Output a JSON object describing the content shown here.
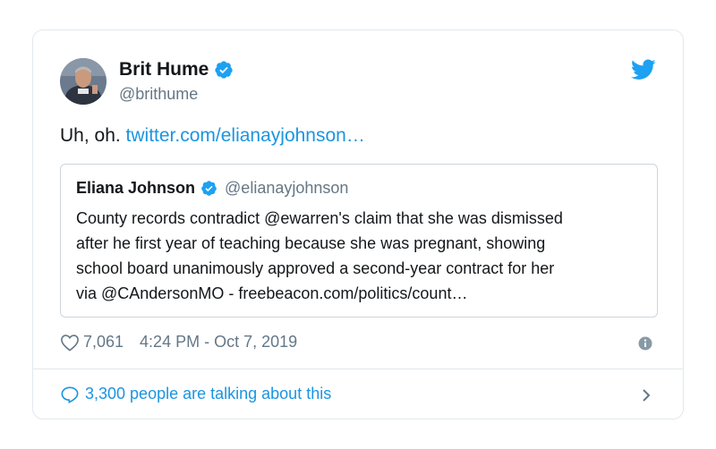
{
  "tweet": {
    "author": {
      "name": "Brit Hume",
      "handle": "@brithume",
      "verified": true
    },
    "text_prefix": "Uh, oh. ",
    "link_text": "twitter.com/elianayjohnson…",
    "quoted": {
      "name": "Eliana Johnson",
      "handle": "@elianayjohnson",
      "verified": true,
      "lines": [
        "County records contradict @ewarren's claim that she was dismissed",
        "after he first year of teaching because she was pregnant, showing",
        "school board unanimously approved a second-year contract for her",
        "via @CAndersonMO - freebeacon.com/politics/count…"
      ]
    },
    "likes": "7,061",
    "timestamp": "4:24 PM - Oct 7, 2019",
    "talking": "3,300 people are talking about this"
  },
  "icons": {
    "bird": "twitter-bird-icon",
    "verified": "verified-badge-icon",
    "heart": "heart-icon",
    "info": "info-icon",
    "bubble": "speech-bubble-icon",
    "chevron": "chevron-right-icon"
  },
  "colors": {
    "brand_blue": "#1da1f2",
    "link_blue": "#1b95e0",
    "muted_gray": "#657786",
    "border": "#e1e8ed"
  }
}
